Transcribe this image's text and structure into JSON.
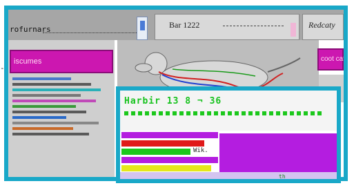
{
  "outer_marker": "-:",
  "header": {
    "brand": "rofurnars",
    "tab_center": "Bar 1222",
    "tab_right": "Redcaty"
  },
  "sidebar": {
    "button_label": "iscumes"
  },
  "hero": {
    "image": "dog-anatomy-illustration"
  },
  "right_button": {
    "label": "coot cat"
  },
  "popup": {
    "title": "Harbir 13 8 ¬ 36",
    "mid_text": "Wik.",
    "foot_text": "th"
  },
  "colors": {
    "frame_border": "#19a8c8",
    "accent_magenta": "#cc17b0",
    "popup_green": "#17c21e",
    "popup_purple": "#b41de0"
  }
}
